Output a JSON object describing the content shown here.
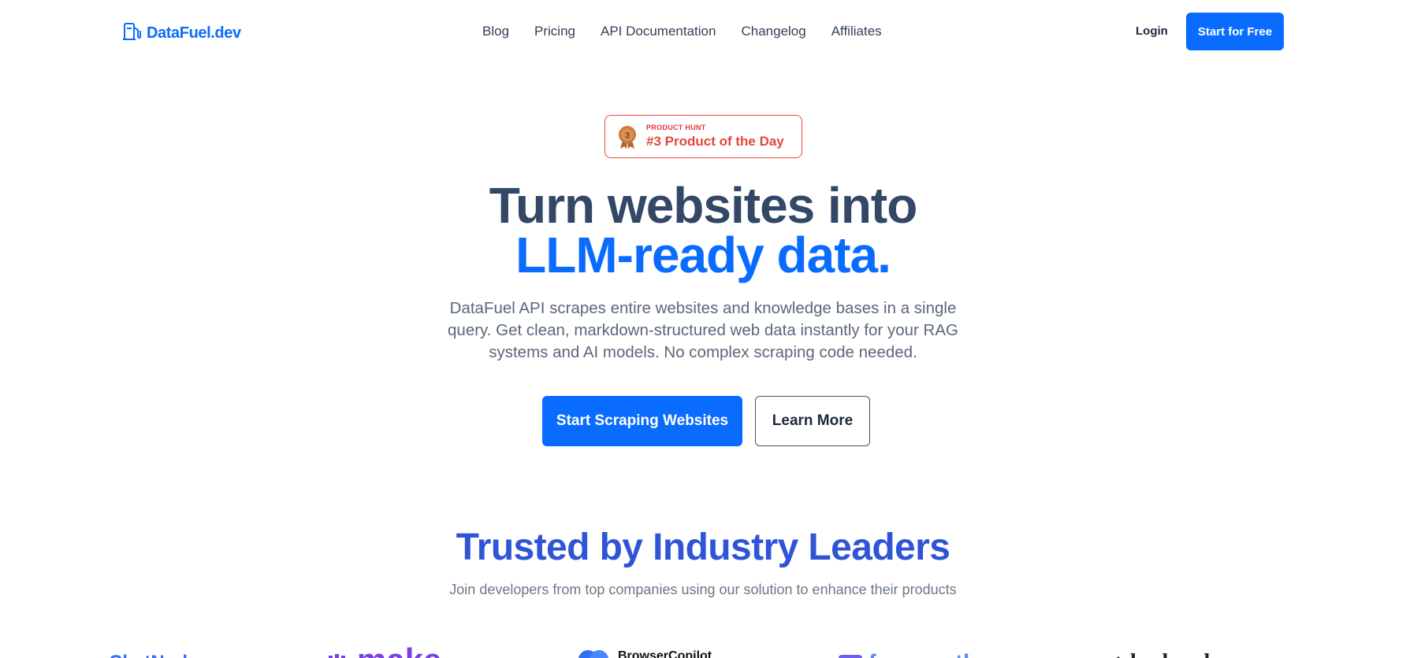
{
  "header": {
    "brand": "DataFuel.dev",
    "nav": [
      "Blog",
      "Pricing",
      "API Documentation",
      "Changelog",
      "Affiliates"
    ],
    "login_label": "Login",
    "cta_label": "Start for Free"
  },
  "badge": {
    "small": "PRODUCT HUNT",
    "big": "#3 Product of the Day",
    "medal_number": "3"
  },
  "hero": {
    "title_line1": "Turn websites into",
    "title_line2": "LLM-ready data.",
    "subtitle": "DataFuel API scrapes entire websites and knowledge bases in a single query. Get clean, markdown-structured web data instantly for your RAG systems and AI models. No complex scraping code needed.",
    "primary_cta": "Start Scraping Websites",
    "secondary_cta": "Learn More"
  },
  "trusted": {
    "title": "Trusted by Industry Leaders",
    "subtitle": "Join developers from top companies using our solution to enhance their products"
  },
  "logos": {
    "items": [
      "ChatNode",
      "make",
      "BrowserCopilot",
      "frequently",
      "hashnode"
    ]
  },
  "colors": {
    "accent": "#0a6cff",
    "title_dark": "#334766",
    "trusted_title": "#2f54d6",
    "badge_red": "#e2463a"
  },
  "icons": [
    "fuel-pump-icon",
    "medal-icon"
  ]
}
